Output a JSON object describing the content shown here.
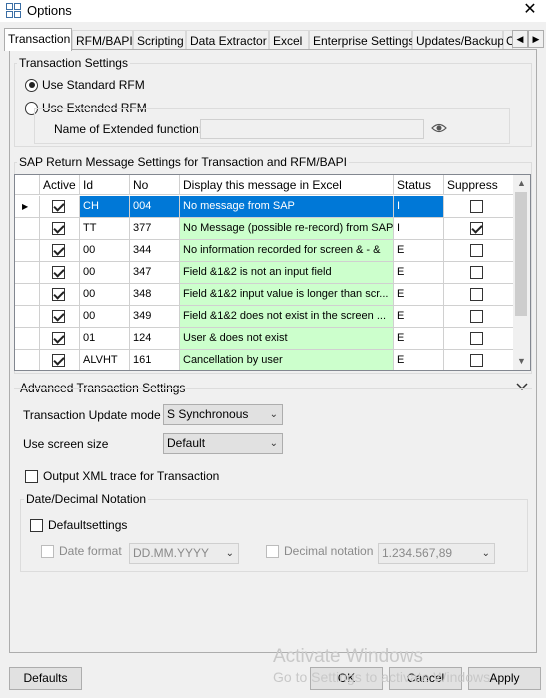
{
  "window": {
    "title": "Options",
    "close_glyph": "✕"
  },
  "tabs": [
    {
      "label": "Transaction"
    },
    {
      "label": "RFM/BAPI"
    },
    {
      "label": "Scripting"
    },
    {
      "label": "Data Extractor"
    },
    {
      "label": "Excel"
    },
    {
      "label": "Enterprise Settings"
    },
    {
      "label": "Updates/Backup"
    },
    {
      "label": "C"
    }
  ],
  "transaction_settings": {
    "title": "Transaction Settings",
    "use_standard_rfm": "Use Standard RFM",
    "use_extended_rfm": "Use Extended RFM",
    "extended_function_label": "Name of Extended function:",
    "extended_function_value": ""
  },
  "return_messages": {
    "title": "SAP Return Message Settings for Transaction and RFM/BAPI",
    "columns": [
      "Active",
      "Id",
      "No",
      "Display this message in Excel",
      "Status",
      "Suppress"
    ],
    "rows": [
      {
        "active": true,
        "id": "CH",
        "no": "004",
        "message": "No message from SAP",
        "status": "I",
        "suppress": false
      },
      {
        "active": true,
        "id": "TT",
        "no": "377",
        "message": "No Message (possible re-record) from SAP",
        "status": "I",
        "suppress": true
      },
      {
        "active": true,
        "id": "00",
        "no": "344",
        "message": "No information recorded for screen & - &",
        "status": "E",
        "suppress": false
      },
      {
        "active": true,
        "id": "00",
        "no": "347",
        "message": "Field &1&2 is not an input field",
        "status": "E",
        "suppress": false
      },
      {
        "active": true,
        "id": "00",
        "no": "348",
        "message": "Field &1&2 input value is longer than scr...",
        "status": "E",
        "suppress": false
      },
      {
        "active": true,
        "id": "00",
        "no": "349",
        "message": "Field &1&2 does not exist in the screen ...",
        "status": "E",
        "suppress": false
      },
      {
        "active": true,
        "id": "01",
        "no": "124",
        "message": "User & does not exist",
        "status": "E",
        "suppress": false
      },
      {
        "active": true,
        "id": "ALVHT",
        "no": "161",
        "message": "Cancellation by user",
        "status": "E",
        "suppress": false
      }
    ]
  },
  "advanced": {
    "title": "Advanced Transaction Settings",
    "update_mode_label": "Transaction Update mode",
    "update_mode_value": "S Synchronous",
    "screen_size_label": "Use screen size",
    "screen_size_value": "Default",
    "xml_trace_label": "Output XML trace for Transaction"
  },
  "date_decimal": {
    "title": "Date/Decimal Notation",
    "default_settings_label": "Defaultsettings",
    "date_format_label": "Date format",
    "date_format_value": "DD.MM.YYYY",
    "decimal_notation_label": "Decimal notation",
    "decimal_notation_value": "1.234.567,89"
  },
  "footer": {
    "defaults_label": "Defaults",
    "ok_label": "OK",
    "cancel_label": "Cancel",
    "apply_label": "Apply"
  },
  "watermark": {
    "line1": "Activate Windows",
    "line2": "Go to Settings to activate Windows."
  },
  "colors": {
    "selection": "#0078d7",
    "message_highlight": "#ccffcc"
  }
}
